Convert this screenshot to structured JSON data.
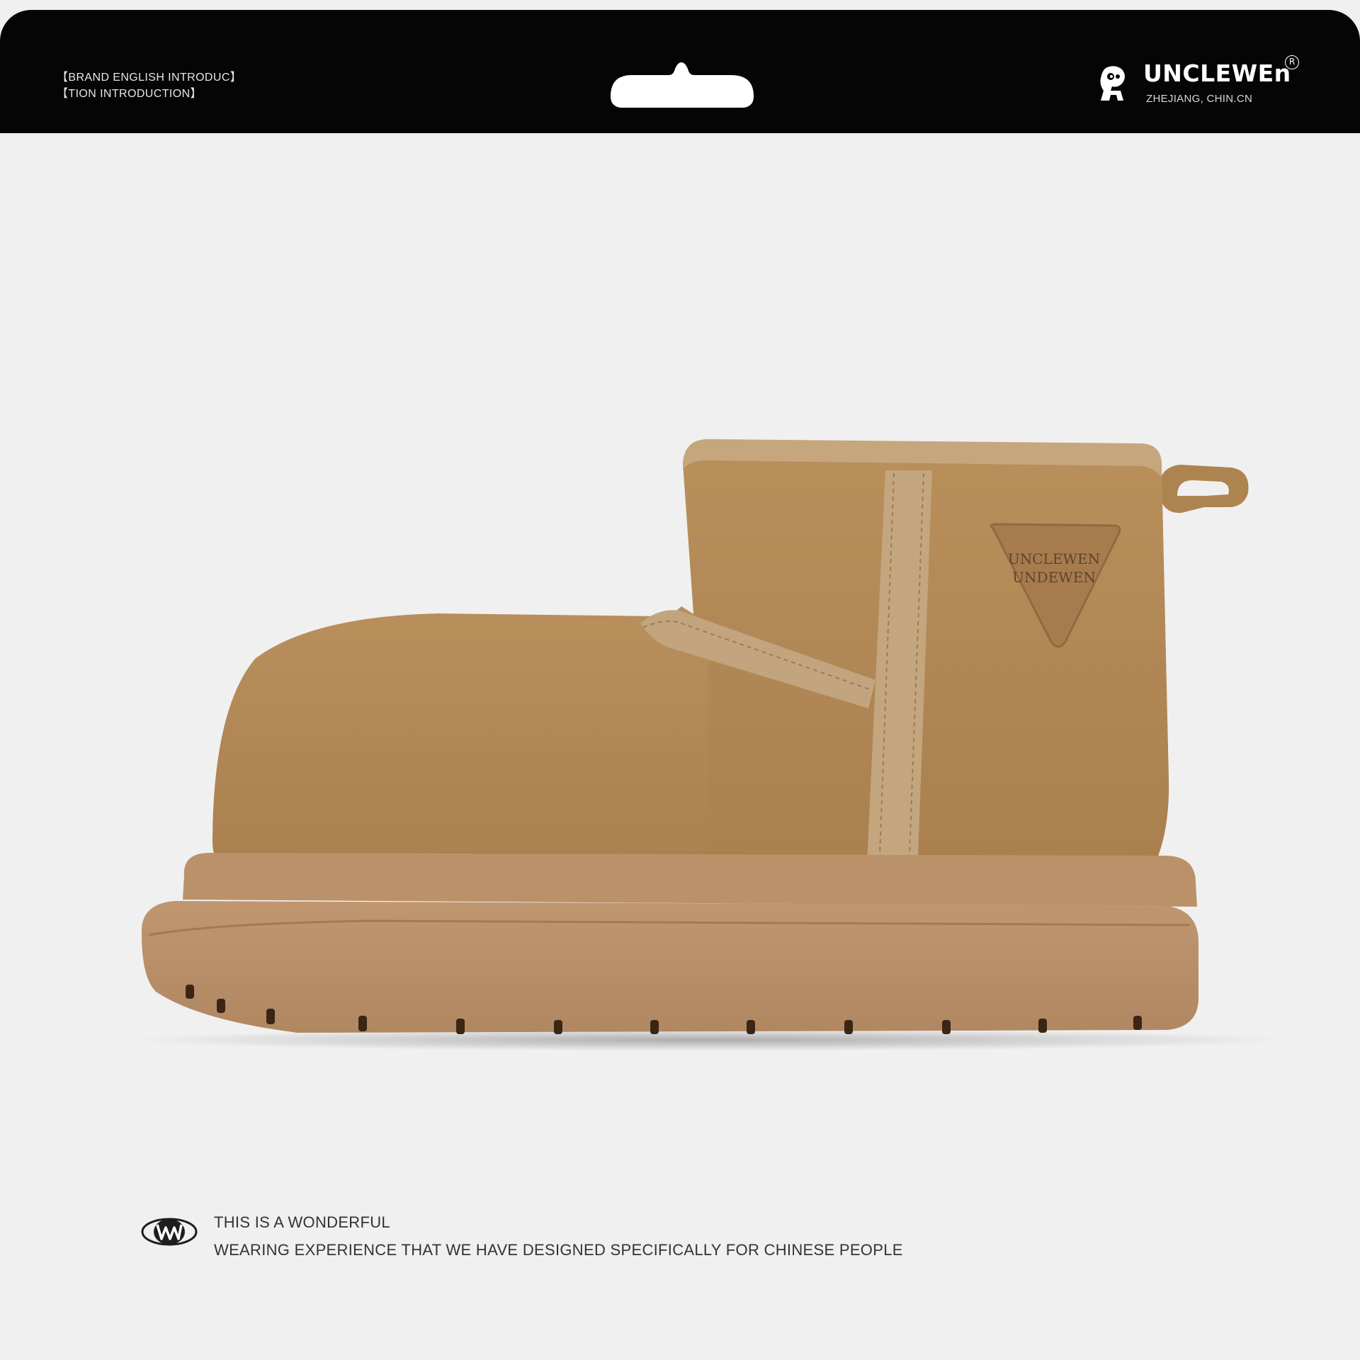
{
  "header": {
    "intro_line_1": "【BRAND ENGLISH INTRODUC】",
    "intro_line_2": "【TION INTRODUCTION】",
    "brand_name": "UNCLEWEn",
    "brand_registered": "R",
    "brand_location": "ZHEJIANG, CHIN.CN"
  },
  "product": {
    "patch_line_1": "UNCLEWEN",
    "patch_line_2": "UNDEWEN",
    "colors": {
      "suede": "#b48a57",
      "sole": "#b98f68",
      "trim": "#c2a57e"
    }
  },
  "footer": {
    "badge_icon": "w-oval-logo-icon",
    "tagline_line_1": "THIS IS A WONDERFUL",
    "tagline_line_2": "WEARING EXPERIENCE THAT WE HAVE DESIGNED SPECIFICALLY FOR CHINESE PEOPLE"
  }
}
